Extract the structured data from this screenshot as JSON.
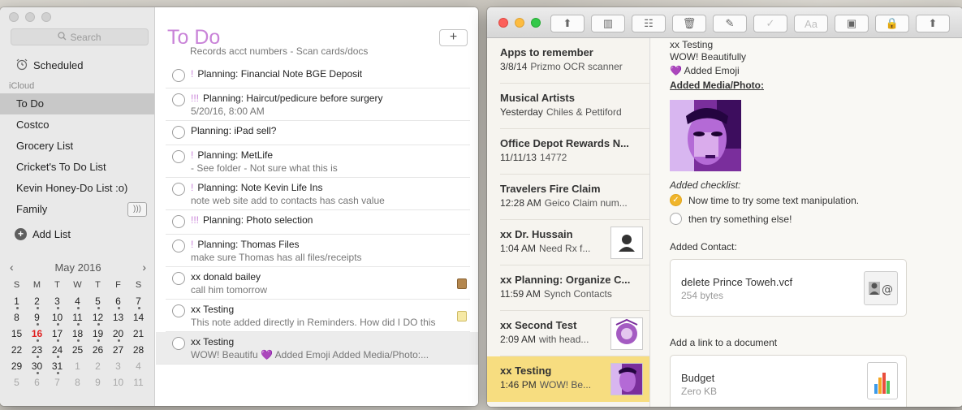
{
  "reminders": {
    "search_placeholder": "Search",
    "scheduled_label": "Scheduled",
    "section_label": "iCloud",
    "lists": [
      {
        "label": "To Do",
        "selected": true
      },
      {
        "label": "Costco"
      },
      {
        "label": "Grocery List"
      },
      {
        "label": "Cricket's To Do List"
      },
      {
        "label": "Kevin Honey-Do List :o)"
      },
      {
        "label": "Family",
        "shared": true
      }
    ],
    "add_list_label": "Add List",
    "calendar": {
      "month_label": "May 2016",
      "weekdays": [
        "S",
        "M",
        "T",
        "W",
        "T",
        "F",
        "S"
      ],
      "weeks": [
        [
          "1",
          "2",
          "3",
          "4",
          "5",
          "6",
          "7"
        ],
        [
          "8",
          "9",
          "10",
          "11",
          "12",
          "13",
          "14"
        ],
        [
          "15",
          "16",
          "17",
          "18",
          "19",
          "20",
          "21"
        ],
        [
          "22",
          "23",
          "24",
          "25",
          "26",
          "27",
          "28"
        ],
        [
          "29",
          "30",
          "31",
          "1",
          "2",
          "3",
          "4"
        ],
        [
          "5",
          "6",
          "7",
          "8",
          "9",
          "10",
          "11"
        ]
      ],
      "today": "16"
    },
    "list_title": "To Do",
    "add_button": "+",
    "partial_item": "Records acct numbers - Scan cards/docs",
    "items": [
      {
        "priority": "!",
        "title": "Planning: Financial Note BGE Deposit",
        "note": ""
      },
      {
        "priority": "!!!",
        "title": "Planning: Haircut/pedicure before surgery",
        "note": "5/20/16, 8:00 AM"
      },
      {
        "priority": "",
        "title": "Planning: iPad sell?",
        "note": ""
      },
      {
        "priority": "!",
        "title": "Planning: MetLife",
        "note": "- See folder - Not sure what this is"
      },
      {
        "priority": "!",
        "title": "Planning: Note Kevin Life Ins",
        "note": "note web site add to contacts has cash value"
      },
      {
        "priority": "!!!",
        "title": "Planning: Photo selection",
        "note": ""
      },
      {
        "priority": "!",
        "title": "Planning: Thomas Files",
        "note": "make sure Thomas has all files/receipts"
      },
      {
        "priority": "",
        "title": "xx donald bailey",
        "note": "call him tomorrow",
        "icon": "contact-card-icon"
      },
      {
        "priority": "",
        "title": "xx Testing",
        "note": "This note added directly in Reminders. How did I DO this",
        "icon": "note-icon"
      },
      {
        "priority": "",
        "title": "xx Testing",
        "note": "WOW! Beautifu 💜 Added Emoji  Added Media/Photo:...",
        "selected": true
      }
    ]
  },
  "notes": {
    "toolbar": [
      "share-icon",
      "sidebar-icon",
      "grid-icon",
      "trash-icon",
      "compose-icon",
      "checklist-icon",
      "font-icon",
      "attachments-icon",
      "lock-icon",
      "share-icon"
    ],
    "list": [
      {
        "title": "Apps to remember",
        "date": "3/8/14",
        "snippet": "Prizmo OCR scanner"
      },
      {
        "title": "Musical Artists",
        "date": "Yesterday",
        "snippet": "Chiles & Pettiford"
      },
      {
        "title": "Office Depot Rewards N...",
        "date": "11/11/13",
        "snippet": "14772"
      },
      {
        "title": "Travelers Fire Claim",
        "date": "12:28 AM",
        "snippet": "Geico Claim num..."
      },
      {
        "title": "xx Dr. Hussain",
        "date": "1:04 AM",
        "snippet": "Need Rx f...",
        "thumb": "contact"
      },
      {
        "title": "xx Planning: Organize C...",
        "date": "11:59 AM",
        "snippet": "Synch Contacts"
      },
      {
        "title": "xx Second Test",
        "date": "2:09 AM",
        "snippet": "with head...",
        "thumb": "art"
      },
      {
        "title": "xx Testing",
        "date": "1:46 PM",
        "snippet": "WOW! Be...",
        "thumb": "photo",
        "selected": true
      }
    ],
    "body": {
      "title": "xx Testing",
      "line1": "WOW! Beautifully",
      "line2": "💜 Added Emoji",
      "media_heading": "Added Media/Photo:",
      "checklist_heading": "Added checklist:",
      "checklist": [
        {
          "text": "Now time to try some text manipulation.",
          "checked": true
        },
        {
          "text": "then try something else!",
          "checked": false
        }
      ],
      "contact_heading": "Added Contact:",
      "contact_file": {
        "name": "delete Prince Toweh.vcf",
        "size": "254 bytes"
      },
      "doc_heading": "Add a link to a document",
      "doc_file": {
        "name": "Budget",
        "size": "Zero KB"
      }
    }
  }
}
